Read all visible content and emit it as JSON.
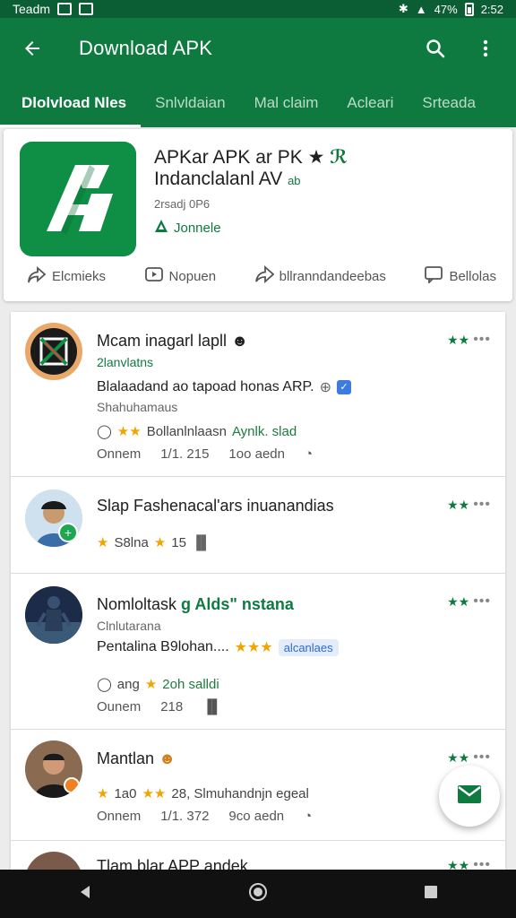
{
  "status_bar": {
    "carrier": "Teadm",
    "battery_text": "47%",
    "time": "2:52"
  },
  "app_bar": {
    "title": "Download APK",
    "icons": [
      "back-arrow-icon",
      "search-icon",
      "more-vert-icon"
    ]
  },
  "tabs": [
    {
      "label": "Dlolvload Nles",
      "active": true
    },
    {
      "label": "Snlvldaian",
      "active": false
    },
    {
      "label": "Mal claim",
      "active": false
    },
    {
      "label": "Acleari",
      "active": false
    },
    {
      "label": "Srteada",
      "active": false
    }
  ],
  "app_card": {
    "title_line1": "APKar APK ar PK",
    "title_line2": "Indanclalanl AV",
    "title_star": "★",
    "title_badge": "ab",
    "size": "2rsadj 0P6",
    "developer": "Jonnele",
    "actions": [
      {
        "label": "Elcmieks",
        "icon": "share-icon"
      },
      {
        "label": "Nopuen",
        "icon": "video-icon"
      },
      {
        "label": "bllranndandeebas",
        "icon": "forward-icon"
      },
      {
        "label": "Bellolas",
        "icon": "comment-icon"
      }
    ]
  },
  "feed": {
    "posts": [
      {
        "name": "Mcam inagarl lapll",
        "handle": "2lanvlatns",
        "body": "Blalaadand ao tapoad honas ARP.",
        "sub": "Shahuhamaus",
        "row_stars": "★★",
        "row_text": "Bollanlnlaasn",
        "row_link": "Aynlk. slad",
        "meta": [
          "Onnem",
          "1/1. 215",
          "1oo aedn"
        ]
      },
      {
        "name": "Slap Fashenacal'ars inuanandias",
        "row_stars": "★",
        "row_text": "S8lna",
        "row_text2": "15"
      },
      {
        "name": "Nomloltask",
        "name_accent": "g Alds\" nstana",
        "handle": "Clnlutarana",
        "body": "Pentalina B9lohan....",
        "body_stars": "★★★",
        "chip": "alcanlaes",
        "row_text": "ang",
        "row_link": "2oh salldi",
        "meta": [
          "Ounem",
          "218"
        ]
      },
      {
        "name": "Mantlan",
        "row_stars": "★",
        "row_text": "1a0",
        "row_text2": "28, Slmuhandnjn egeal",
        "meta": [
          "Onnem",
          "1/1. 372",
          "9co aedn"
        ]
      },
      {
        "name": "Tlam blar APP andek"
      }
    ],
    "rating_stars": "★★",
    "more": "•••"
  },
  "colors": {
    "primary": "#0e7a40",
    "status": "#0b5e34",
    "star": "#f2a400",
    "chip_blue": "#2d6ad6"
  }
}
